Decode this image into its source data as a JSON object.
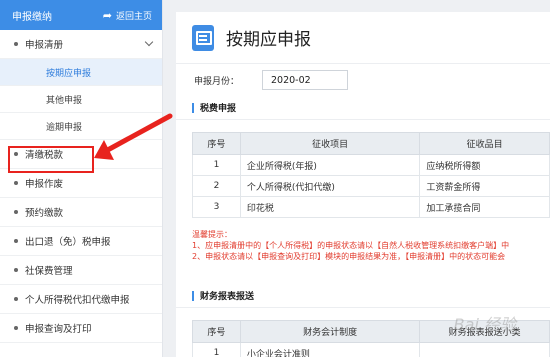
{
  "sidebar": {
    "title": "申报缴纳",
    "home_label": "返回主页",
    "menu": [
      {
        "label": "申报清册",
        "expanded": true,
        "children": [
          {
            "label": "按期应申报",
            "active": true
          },
          {
            "label": "其他申报"
          },
          {
            "label": "逾期申报"
          }
        ]
      },
      {
        "label": "清缴税款",
        "highlighted": true
      },
      {
        "label": "申报作废"
      },
      {
        "label": "预约缴款"
      },
      {
        "label": "出口退（免）税申报"
      },
      {
        "label": "社保费管理"
      },
      {
        "label": "个人所得税代扣代缴申报"
      },
      {
        "label": "申报查询及打印"
      }
    ]
  },
  "main": {
    "title": "按期应申报",
    "period_label": "申报月份：",
    "period_value": "2020-02",
    "tax_section": {
      "title": "税费申报",
      "headers": [
        "序号",
        "征收项目",
        "征收品目"
      ],
      "rows": [
        [
          "1",
          "企业所得税(年报)",
          "应纳税所得额"
        ],
        [
          "2",
          "个人所得税(代扣代缴)",
          "工资薪金所得"
        ],
        [
          "3",
          "印花税",
          "加工承揽合同"
        ]
      ]
    },
    "tips": {
      "title": "温馨提示：",
      "lines": [
        "1、应申报清册中的【个人所得税】的申报状态请以【自然人税收管理系统扣缴客户端】中",
        "2、申报状态请以【申报查询及打印】模块的申报结果为准，【申报清册】中的状态可能会"
      ]
    },
    "finance_section": {
      "title": "财务报表报送",
      "headers": [
        "序号",
        "财务会计制度",
        "财务报表报送小类"
      ],
      "rows": [
        [
          "1",
          "小企业会计准则",
          ""
        ]
      ]
    },
    "watermark": "Bai 经验"
  },
  "colors": {
    "accent": "#3d8de6",
    "highlight": "#e8231e",
    "tip_text": "#e23c2e"
  }
}
